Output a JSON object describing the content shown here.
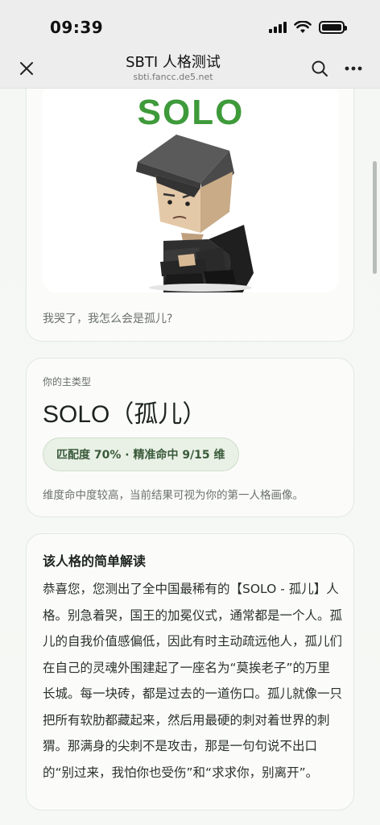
{
  "status": {
    "time": "09:39"
  },
  "nav": {
    "title": "SBTI 人格测试",
    "subtitle": "sbti.fancc.de5.net"
  },
  "image_card": {
    "logo_text": "SOLO",
    "caption": "我哭了，我怎么会是孤儿?"
  },
  "type_card": {
    "label": "你的主类型",
    "name": "SOLO（孤儿）",
    "match": "匹配度 70% · 精准命中 9/15 维",
    "description": "维度命中度较高，当前结果可视为你的第一人格画像。"
  },
  "reading_card": {
    "title": "该人格的简单解读",
    "body": "恭喜您，您测出了全中国最稀有的【SOLO - 孤儿】人格。别急着哭，国王的加冕仪式，通常都是一个人。孤儿的自我价值感偏低，因此有时主动疏远他人，孤儿们在自己的灵魂外围建起了一座名为“莫挨老子”的万里长城。每一块砖，都是过去的一道伤口。孤儿就像一只把所有软肋都藏起来，然后用最硬的刺对着世界的刺猬。那满身的尖刺不是攻击，那是一句句说不出口的“别过来，我怕你也受伤”和“求求你，别离开”。"
  },
  "colors": {
    "accent_green": "#3e9a3a",
    "pill_bg": "#e9f1e7"
  }
}
